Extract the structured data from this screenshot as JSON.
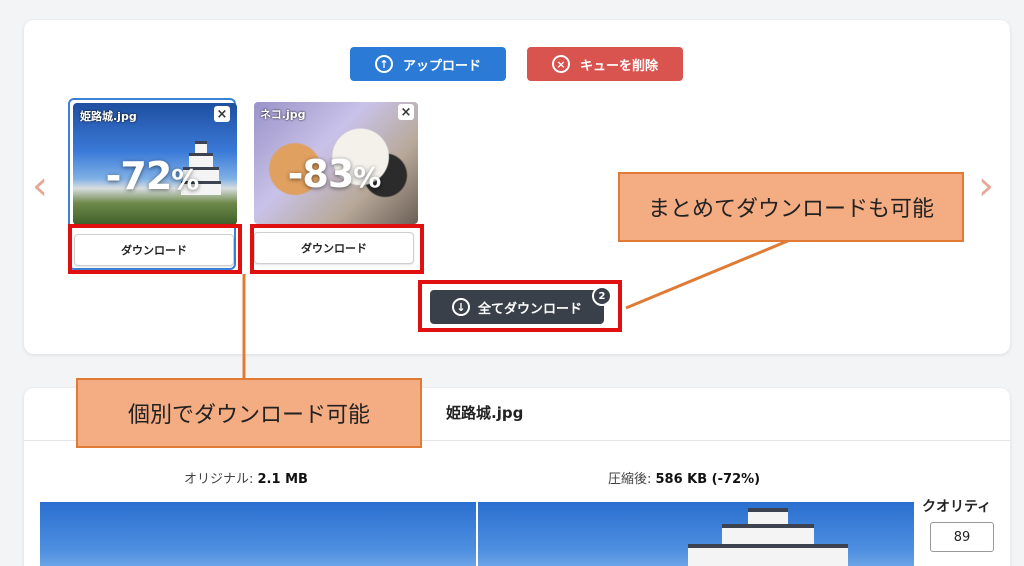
{
  "toolbar": {
    "upload_label": "アップロード",
    "clear_label": "キューを削除"
  },
  "icons": {
    "upload_icon": "↑",
    "clear_icon": "×",
    "download_icon": "↓",
    "prev_arrow": "‹",
    "next_arrow": "›",
    "close_icon": "×"
  },
  "queue": {
    "items": [
      {
        "name": "姫路城.jpg",
        "reduction": "-72",
        "percent_sign": "%",
        "download_label": "ダウンロード"
      },
      {
        "name": "ネコ.jpg",
        "reduction": "-83",
        "percent_sign": "%",
        "download_label": "ダウンロード"
      }
    ],
    "download_all_label": "全てダウンロード",
    "download_all_count": "2"
  },
  "annotations": {
    "bulk": "まとめてダウンロードも可能",
    "each": "個別でダウンロード可能"
  },
  "detail": {
    "file_name": "姫路城.jpg",
    "original_prefix": "オリジナル: ",
    "original_size": "2.1 MB",
    "compressed_prefix": "圧縮後: ",
    "compressed_size": "586 KB (-72%)",
    "quality_label": "クオリティ",
    "quality_value": "89"
  },
  "colors": {
    "upload": "#2b7bd6",
    "clear": "#d9534f",
    "download_all": "#3a4049",
    "highlight": "#e01010",
    "callout": "#f4ac82"
  }
}
